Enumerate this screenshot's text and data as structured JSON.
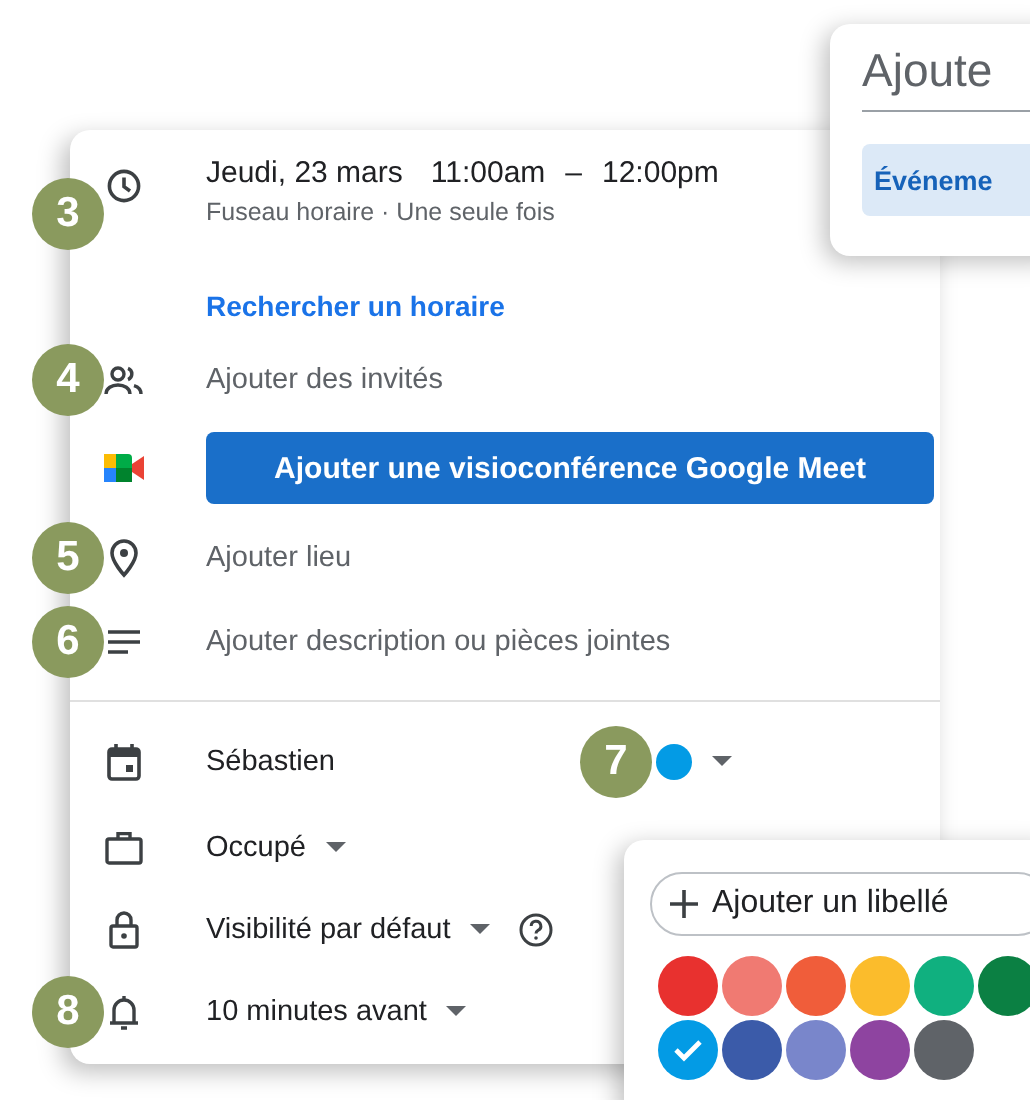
{
  "top_card": {
    "title": "Ajoute",
    "tab": "Événeme",
    "tab_selected": true
  },
  "rows": [
    {
      "kind": "time",
      "marker": "3",
      "date": "Jeudi, 23 mars",
      "start": "11:00am",
      "dash": "–",
      "end": "12:00pm",
      "subtitle": "Fuseau horaire · Une seule fois"
    },
    {
      "kind": "link",
      "label": "Rechercher un horaire"
    },
    {
      "kind": "guests",
      "marker": "4",
      "label": "Ajouter des invités"
    },
    {
      "kind": "meet",
      "label": "Ajouter une visioconférence Google Meet"
    },
    {
      "kind": "location",
      "marker": "5",
      "label": "Ajouter lieu"
    },
    {
      "kind": "description",
      "marker": "6",
      "label": "Ajouter description ou pièces jointes"
    },
    {
      "kind": "divider"
    },
    {
      "kind": "calendar",
      "marker": "7",
      "label": "Sébastien",
      "color": "#039be5"
    },
    {
      "kind": "availability",
      "label": "Occupé"
    },
    {
      "kind": "visibility",
      "label": "Visibilité par défaut"
    },
    {
      "kind": "reminder",
      "marker": "8",
      "label": "10 minutes avant"
    }
  ],
  "color_menu": {
    "add_label": "Ajouter un libellé",
    "colors": [
      {
        "color": "#e8312f",
        "selected": false
      },
      {
        "color": "#f07a72",
        "selected": false
      },
      {
        "color": "#f05d3a",
        "selected": false
      },
      {
        "color": "#fbbc2c",
        "selected": false
      },
      {
        "color": "#10b07f",
        "selected": false
      },
      {
        "color": "#0b8043",
        "selected": false
      },
      {
        "color": "#039be5",
        "selected": true
      },
      {
        "color": "#3b5ba9",
        "selected": false
      },
      {
        "color": "#7986cb",
        "selected": false
      },
      {
        "color": "#8e44a0",
        "selected": false
      },
      {
        "color": "#5f6368",
        "selected": false
      }
    ]
  }
}
